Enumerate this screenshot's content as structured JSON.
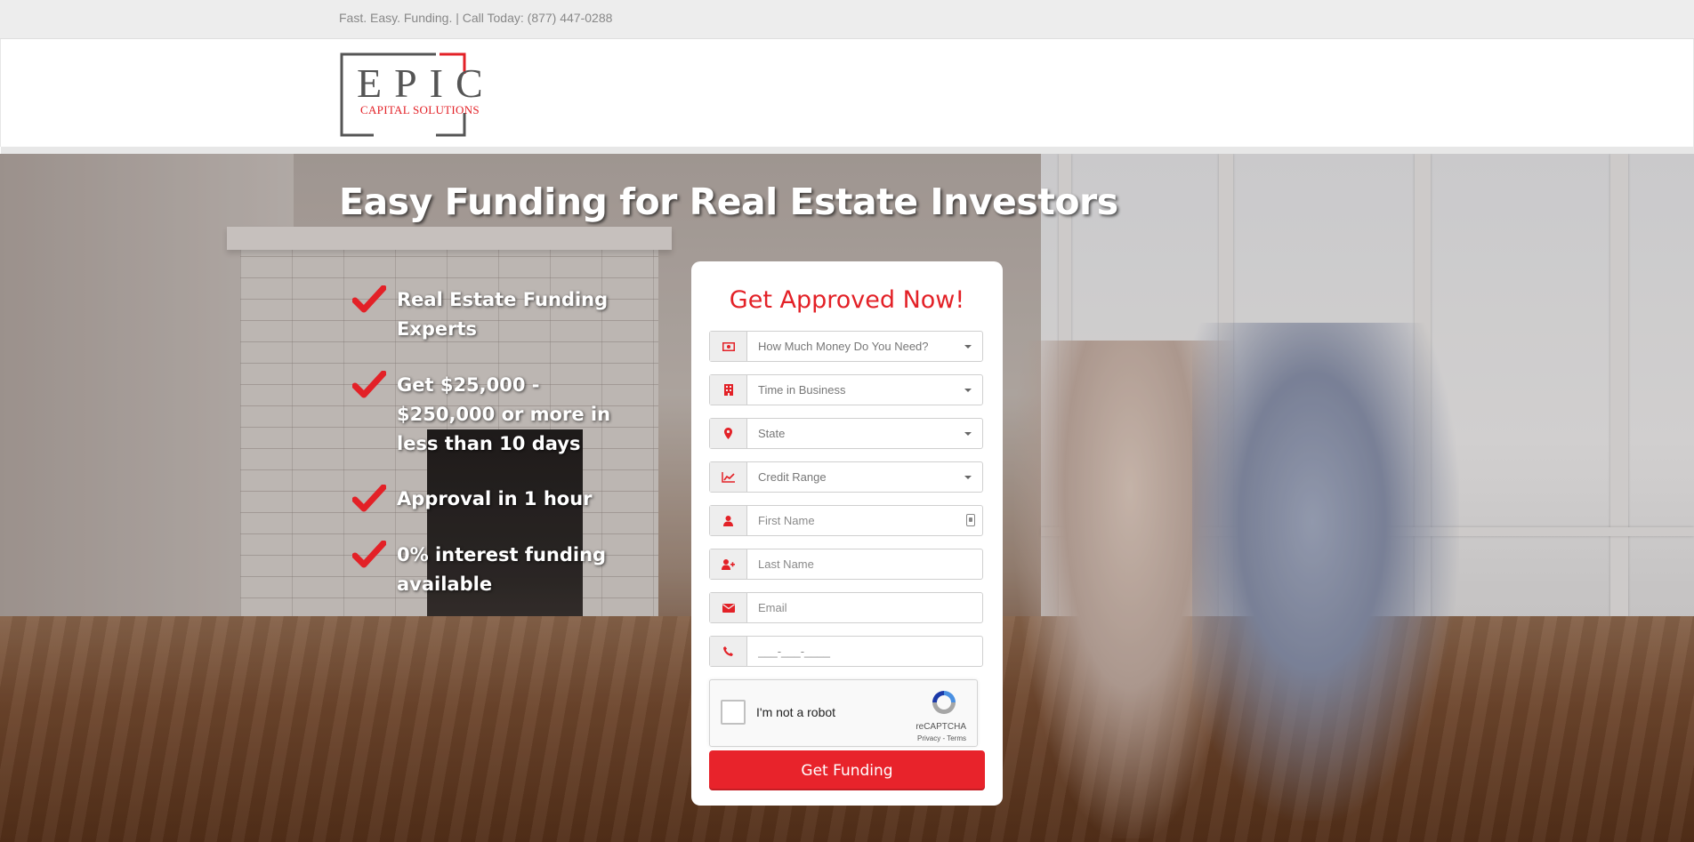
{
  "topbar": {
    "tagline": "Fast. Easy. Funding. | Call Today: (877) 447-0288"
  },
  "brand": {
    "logo_word": "EPIC",
    "logo_subtitle": "CAPITAL SOLUTIONS",
    "accent_color": "#e32127",
    "logo_gray": "#555555"
  },
  "hero": {
    "title": "Easy Funding for Real Estate Investors",
    "benefits": [
      "Real Estate Funding Experts",
      "Get $25,000 - $250,000 or more in less than 10 days",
      "Approval in 1 hour",
      "0% interest funding available"
    ],
    "check_icon": "check-icon"
  },
  "form": {
    "title": "Get Approved Now!",
    "fields": [
      {
        "icon": "money-icon",
        "type": "select",
        "placeholder": "How Much Money Do You Need?"
      },
      {
        "icon": "building-icon",
        "type": "select",
        "placeholder": "Time in Business"
      },
      {
        "icon": "map-pin-icon",
        "type": "select",
        "placeholder": "State"
      },
      {
        "icon": "line-chart-icon",
        "type": "select",
        "placeholder": "Credit Range"
      },
      {
        "icon": "user-icon",
        "type": "text",
        "placeholder": "First Name"
      },
      {
        "icon": "user-plus-icon",
        "type": "text",
        "placeholder": "Last Name"
      },
      {
        "icon": "envelope-icon",
        "type": "text",
        "placeholder": "Email"
      },
      {
        "icon": "phone-icon",
        "type": "text",
        "placeholder": "___-___-____"
      }
    ],
    "recaptcha": {
      "label": "I'm not a robot",
      "brand": "reCAPTCHA",
      "terms": "Privacy - Terms"
    },
    "submit_label": "Get Funding"
  }
}
